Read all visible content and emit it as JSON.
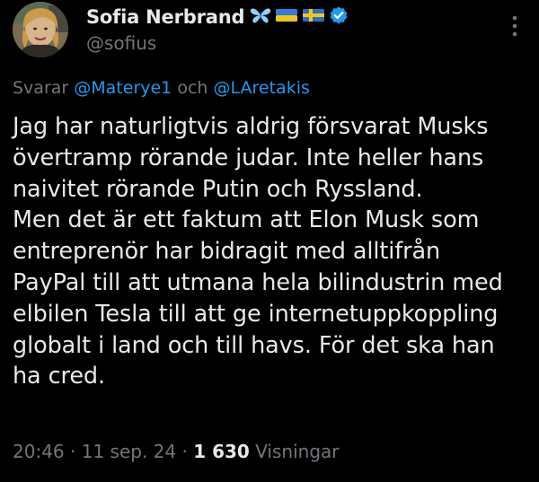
{
  "author": {
    "display_name": "Sofia Nerbrand",
    "handle": "@sofius",
    "name_badges": [
      "butterfly-icon",
      "ukraine-flag-icon",
      "sweden-flag-icon",
      "verified-badge-icon"
    ]
  },
  "reply": {
    "prefix": "Svarar",
    "mention_1": "@Materye1",
    "conjunction": "och",
    "mention_2": "@LAretakis"
  },
  "body": {
    "lines": [
      "Jag har naturligtvis aldrig försvarat Musks",
      "övertramp rörande judar. Inte heller hans",
      "naivitet rörande Putin och Ryssland.",
      "Men det är ett faktum att Elon Musk som",
      "entreprenör har bidragit med alltifrån",
      "PayPal till att utmana hela bilindustrin med",
      "elbilen Tesla till att ge internetuppkoppling",
      "globalt i land och till havs. För det ska han",
      "ha cred."
    ]
  },
  "meta": {
    "time": "20:46",
    "separator": "·",
    "date": "11 sep. 24",
    "views_count": "1 630",
    "views_label": "Visningar"
  },
  "colors": {
    "background": "#000000",
    "text_primary": "#e7e9ea",
    "text_secondary": "#71767b",
    "link": "#1d9bf0",
    "verified": "#1d9bf0"
  }
}
